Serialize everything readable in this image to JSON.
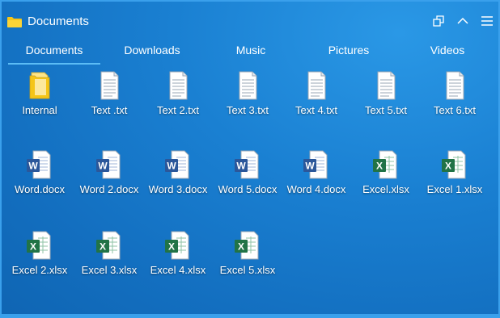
{
  "window": {
    "title": "Documents"
  },
  "tabs": [
    {
      "label": "Documents",
      "active": true
    },
    {
      "label": "Downloads",
      "active": false
    },
    {
      "label": "Music",
      "active": false
    },
    {
      "label": "Pictures",
      "active": false
    },
    {
      "label": "Videos",
      "active": false
    }
  ],
  "files": [
    {
      "label": "Internal",
      "type": "folder"
    },
    {
      "label": "Text .txt",
      "type": "txt"
    },
    {
      "label": "Text 2.txt",
      "type": "txt"
    },
    {
      "label": "Text 3.txt",
      "type": "txt"
    },
    {
      "label": "Text 4.txt",
      "type": "txt"
    },
    {
      "label": "Text 5.txt",
      "type": "txt"
    },
    {
      "label": "Text 6.txt",
      "type": "txt"
    },
    {
      "label": "Word.docx",
      "type": "word"
    },
    {
      "label": "Word 2.docx",
      "type": "word"
    },
    {
      "label": "Word 3.docx",
      "type": "word"
    },
    {
      "label": "Word 5.docx",
      "type": "word"
    },
    {
      "label": "Word 4.docx",
      "type": "word"
    },
    {
      "label": "Excel.xlsx",
      "type": "excel"
    },
    {
      "label": "Excel 1.xlsx",
      "type": "excel"
    },
    {
      "label": "Excel 2.xlsx",
      "type": "excel"
    },
    {
      "label": "Excel 3.xlsx",
      "type": "excel"
    },
    {
      "label": "Excel 4.xlsx",
      "type": "excel"
    },
    {
      "label": "Excel 5.xlsx",
      "type": "excel"
    }
  ],
  "colors": {
    "accent": "#5bbcf5",
    "word": "#2b579a",
    "excel": "#217346",
    "folder": "#f5c518"
  }
}
